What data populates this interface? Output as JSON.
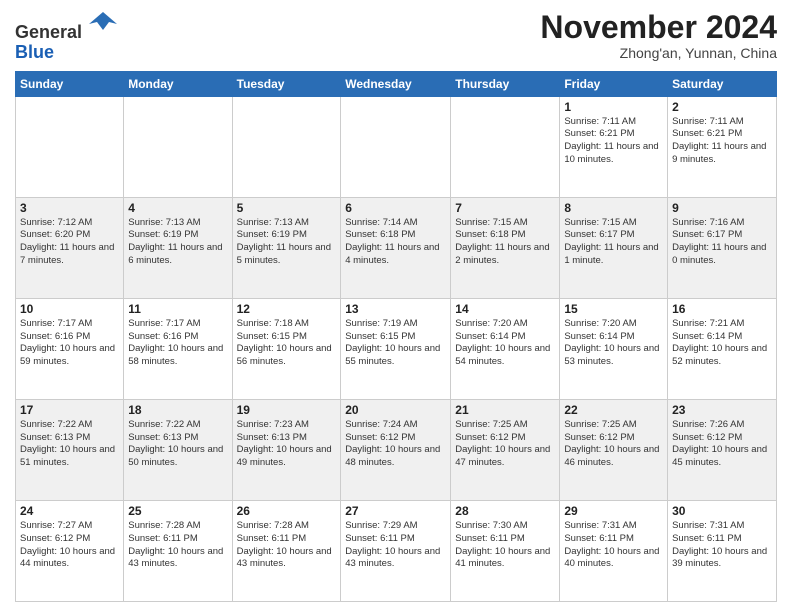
{
  "logo": {
    "general": "General",
    "blue": "Blue"
  },
  "header": {
    "month": "November 2024",
    "location": "Zhong'an, Yunnan, China"
  },
  "weekdays": [
    "Sunday",
    "Monday",
    "Tuesday",
    "Wednesday",
    "Thursday",
    "Friday",
    "Saturday"
  ],
  "weeks": [
    [
      {
        "day": "",
        "info": ""
      },
      {
        "day": "",
        "info": ""
      },
      {
        "day": "",
        "info": ""
      },
      {
        "day": "",
        "info": ""
      },
      {
        "day": "",
        "info": ""
      },
      {
        "day": "1",
        "info": "Sunrise: 7:11 AM\nSunset: 6:21 PM\nDaylight: 11 hours and 10 minutes."
      },
      {
        "day": "2",
        "info": "Sunrise: 7:11 AM\nSunset: 6:21 PM\nDaylight: 11 hours and 9 minutes."
      }
    ],
    [
      {
        "day": "3",
        "info": "Sunrise: 7:12 AM\nSunset: 6:20 PM\nDaylight: 11 hours and 7 minutes."
      },
      {
        "day": "4",
        "info": "Sunrise: 7:13 AM\nSunset: 6:19 PM\nDaylight: 11 hours and 6 minutes."
      },
      {
        "day": "5",
        "info": "Sunrise: 7:13 AM\nSunset: 6:19 PM\nDaylight: 11 hours and 5 minutes."
      },
      {
        "day": "6",
        "info": "Sunrise: 7:14 AM\nSunset: 6:18 PM\nDaylight: 11 hours and 4 minutes."
      },
      {
        "day": "7",
        "info": "Sunrise: 7:15 AM\nSunset: 6:18 PM\nDaylight: 11 hours and 2 minutes."
      },
      {
        "day": "8",
        "info": "Sunrise: 7:15 AM\nSunset: 6:17 PM\nDaylight: 11 hours and 1 minute."
      },
      {
        "day": "9",
        "info": "Sunrise: 7:16 AM\nSunset: 6:17 PM\nDaylight: 11 hours and 0 minutes."
      }
    ],
    [
      {
        "day": "10",
        "info": "Sunrise: 7:17 AM\nSunset: 6:16 PM\nDaylight: 10 hours and 59 minutes."
      },
      {
        "day": "11",
        "info": "Sunrise: 7:17 AM\nSunset: 6:16 PM\nDaylight: 10 hours and 58 minutes."
      },
      {
        "day": "12",
        "info": "Sunrise: 7:18 AM\nSunset: 6:15 PM\nDaylight: 10 hours and 56 minutes."
      },
      {
        "day": "13",
        "info": "Sunrise: 7:19 AM\nSunset: 6:15 PM\nDaylight: 10 hours and 55 minutes."
      },
      {
        "day": "14",
        "info": "Sunrise: 7:20 AM\nSunset: 6:14 PM\nDaylight: 10 hours and 54 minutes."
      },
      {
        "day": "15",
        "info": "Sunrise: 7:20 AM\nSunset: 6:14 PM\nDaylight: 10 hours and 53 minutes."
      },
      {
        "day": "16",
        "info": "Sunrise: 7:21 AM\nSunset: 6:14 PM\nDaylight: 10 hours and 52 minutes."
      }
    ],
    [
      {
        "day": "17",
        "info": "Sunrise: 7:22 AM\nSunset: 6:13 PM\nDaylight: 10 hours and 51 minutes."
      },
      {
        "day": "18",
        "info": "Sunrise: 7:22 AM\nSunset: 6:13 PM\nDaylight: 10 hours and 50 minutes."
      },
      {
        "day": "19",
        "info": "Sunrise: 7:23 AM\nSunset: 6:13 PM\nDaylight: 10 hours and 49 minutes."
      },
      {
        "day": "20",
        "info": "Sunrise: 7:24 AM\nSunset: 6:12 PM\nDaylight: 10 hours and 48 minutes."
      },
      {
        "day": "21",
        "info": "Sunrise: 7:25 AM\nSunset: 6:12 PM\nDaylight: 10 hours and 47 minutes."
      },
      {
        "day": "22",
        "info": "Sunrise: 7:25 AM\nSunset: 6:12 PM\nDaylight: 10 hours and 46 minutes."
      },
      {
        "day": "23",
        "info": "Sunrise: 7:26 AM\nSunset: 6:12 PM\nDaylight: 10 hours and 45 minutes."
      }
    ],
    [
      {
        "day": "24",
        "info": "Sunrise: 7:27 AM\nSunset: 6:12 PM\nDaylight: 10 hours and 44 minutes."
      },
      {
        "day": "25",
        "info": "Sunrise: 7:28 AM\nSunset: 6:11 PM\nDaylight: 10 hours and 43 minutes."
      },
      {
        "day": "26",
        "info": "Sunrise: 7:28 AM\nSunset: 6:11 PM\nDaylight: 10 hours and 43 minutes."
      },
      {
        "day": "27",
        "info": "Sunrise: 7:29 AM\nSunset: 6:11 PM\nDaylight: 10 hours and 43 minutes."
      },
      {
        "day": "28",
        "info": "Sunrise: 7:30 AM\nSunset: 6:11 PM\nDaylight: 10 hours and 41 minutes."
      },
      {
        "day": "29",
        "info": "Sunrise: 7:31 AM\nSunset: 6:11 PM\nDaylight: 10 hours and 40 minutes."
      },
      {
        "day": "30",
        "info": "Sunrise: 7:31 AM\nSunset: 6:11 PM\nDaylight: 10 hours and 39 minutes."
      }
    ]
  ]
}
